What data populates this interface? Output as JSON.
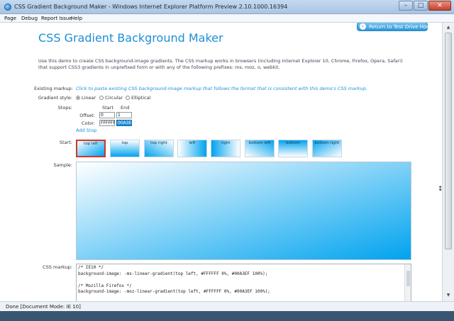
{
  "window": {
    "title": "CSS Gradient Background Maker - Windows Internet Explorer Platform Preview 2.10.1000.16394",
    "minimize": "–",
    "maximize": "□",
    "close": "✕"
  },
  "menu": [
    "Page",
    "Debug",
    "Report Issue",
    "Help"
  ],
  "page": {
    "return_button": "Return to Test Drive Home",
    "title": "CSS Gradient Background Maker",
    "intro": "Use this demo to create CSS background-image gradients. The CSS markup works in browsers (including Internet Explorer 10, Chrome, Firefox, Opera, Safari) that support CSS3 gradients in unprefixed form or with any of the following prefixes: ms, moz, o, webkit.",
    "existing_markup_label": "Existing markup:",
    "existing_markup_hint": "Click to paste existing CSS background-image markup that follows the format that is consistent with this demo's CSS markup.",
    "gradient_style_label": "Gradient style:",
    "gradient_styles": [
      {
        "label": "Linear",
        "selected": true
      },
      {
        "label": "Circular",
        "selected": false
      },
      {
        "label": "Elliptical",
        "selected": false
      }
    ],
    "stops_label": "Stops:",
    "start_header": "Start",
    "end_header": "End",
    "offset_label": "Offset:",
    "offset_start": "0",
    "offset_end": "1",
    "color_label": "Color:",
    "color_start": "FFFFFF",
    "color_end": "00A3EF",
    "add_stop": "Add Stop",
    "start_label": "Start:",
    "start_positions": [
      "top left",
      "top",
      "top right",
      "left",
      "right",
      "bottom left",
      "bottom",
      "bottom right"
    ],
    "selected_start": "top left",
    "sample_label": "Sample:",
    "css_markup_label": "CSS markup:",
    "css_markup": "/* IE10 */\nbackground-image: -ms-linear-gradient(top left, #FFFFFF 0%, #00A3EF 100%);\n\n/* Mozilla Firefox */\nbackground-image: -moz-linear-gradient(top left, #FFFFFF 0%, #00A3EF 100%);\n\n/* Opera */"
  },
  "colors": {
    "accent": "#1c8fd6",
    "gradient_start": "#FFFFFF",
    "gradient_end": "#00A3EF",
    "selected_border": "#d0342c"
  },
  "status": "Done [Document Mode: IE 10]"
}
